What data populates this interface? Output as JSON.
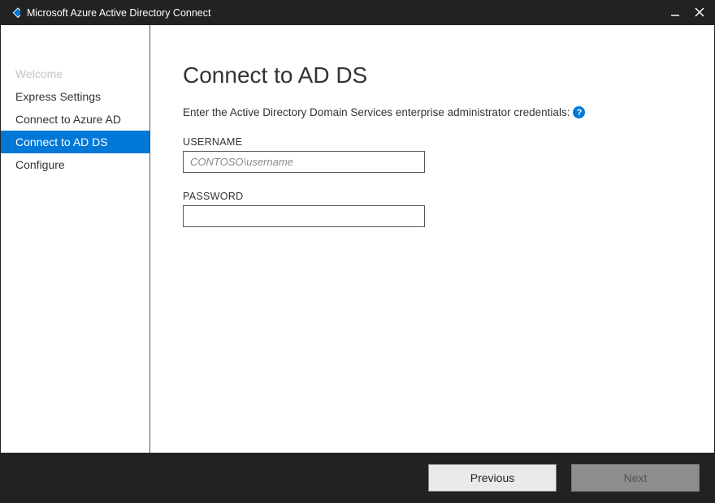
{
  "window": {
    "title": "Microsoft Azure Active Directory Connect"
  },
  "sidebar": {
    "items": [
      {
        "label": "Welcome",
        "state": "disabled"
      },
      {
        "label": "Express Settings",
        "state": "normal"
      },
      {
        "label": "Connect to Azure AD",
        "state": "normal"
      },
      {
        "label": "Connect to AD DS",
        "state": "active"
      },
      {
        "label": "Configure",
        "state": "normal"
      }
    ]
  },
  "main": {
    "title": "Connect to AD DS",
    "instruction": "Enter the Active Directory Domain Services enterprise administrator credentials:",
    "help_icon": "?",
    "username_label": "USERNAME",
    "username_placeholder": "CONTOSO\\username",
    "username_value": "",
    "password_label": "PASSWORD",
    "password_value": ""
  },
  "footer": {
    "previous_label": "Previous",
    "next_label": "Next"
  }
}
